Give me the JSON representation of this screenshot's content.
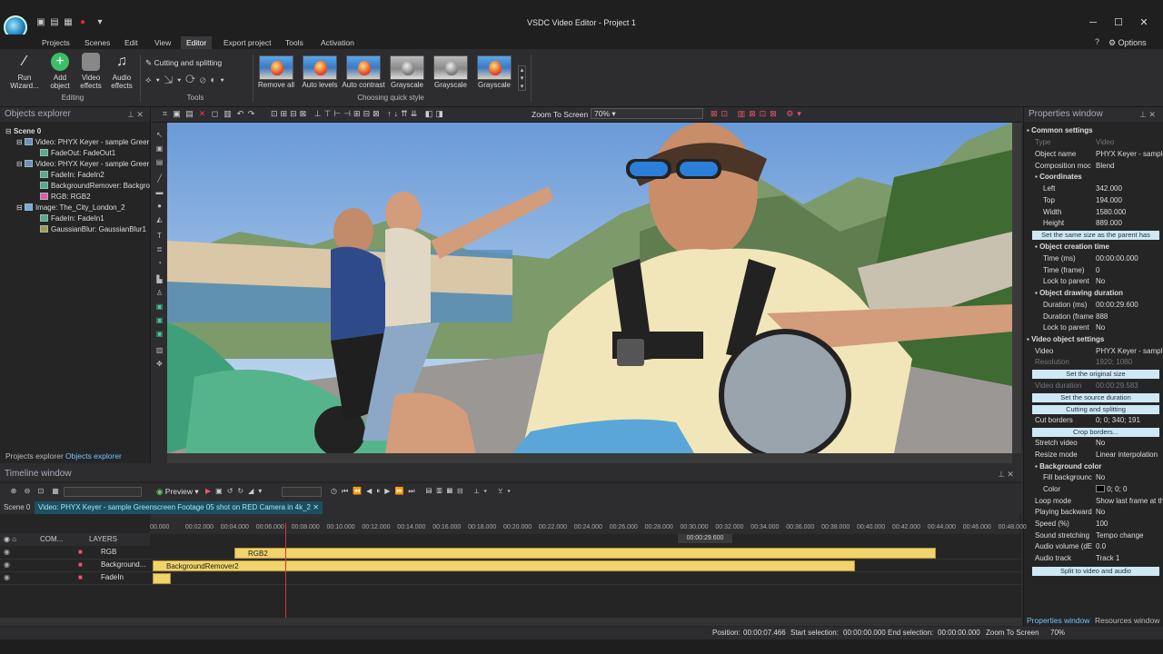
{
  "window": {
    "title": "VSDC Video Editor - Project 1"
  },
  "menu": [
    "Projects",
    "Scenes",
    "Edit",
    "View",
    "Editor",
    "Export project",
    "Tools",
    "Activation"
  ],
  "menu_active": "Editor",
  "options_label": "Options",
  "ribbon": {
    "run_wizard": "Run Wizard...",
    "add_object": "Add object",
    "video_effects": "Video effects",
    "audio_effects": "Audio effects",
    "editing_group": "Editing",
    "cutting_splitting": "Cutting and splitting",
    "tools_group": "Tools",
    "quick_styles": [
      "Remove all",
      "Auto levels",
      "Auto contrast",
      "Grayscale",
      "Grayscale",
      "Grayscale"
    ],
    "quick_group": "Choosing quick style"
  },
  "objects_explorer": {
    "title": "Objects explorer",
    "items": [
      "Scene 0",
      "Video: PHYX Keyer - sample Greer",
      "FadeOut: FadeOut1",
      "Video: PHYX Keyer - sample Greer",
      "FadeIn: FadeIn2",
      "BackgroundRemover: Backgro",
      "RGB: RGB2",
      "Image: The_City_London_2",
      "FadeIn: FadeIn1",
      "GaussianBlur: GaussianBlur1"
    ],
    "tabs": [
      "Projects explorer",
      "Objects explorer"
    ]
  },
  "canvas_toolbar": {
    "zoom_label": "Zoom To Screen",
    "zoom_value": "70%"
  },
  "properties": {
    "title": "Properties window",
    "common": "Common settings",
    "rows": [
      {
        "k": "Type",
        "v": "Video",
        "dis": true
      },
      {
        "k": "Object name",
        "v": "PHYX Keyer - sample"
      },
      {
        "k": "Composition moc",
        "v": "Blend"
      },
      {
        "k": "Coordinates",
        "v": "",
        "sec": true
      },
      {
        "k": "Left",
        "v": "342.000"
      },
      {
        "k": "Top",
        "v": "194.000"
      },
      {
        "k": "Width",
        "v": "1580.000"
      },
      {
        "k": "Height",
        "v": "889.000"
      }
    ],
    "btn_same_size": "Set the same size as the parent has",
    "creation_title": "Object creation time",
    "creation_rows": [
      {
        "k": "Time (ms)",
        "v": "00:00:00.000"
      },
      {
        "k": "Time (frame)",
        "v": "0"
      },
      {
        "k": "Lock to parent",
        "v": "No"
      }
    ],
    "duration_title": "Object drawing duration",
    "duration_rows": [
      {
        "k": "Duration (ms)",
        "v": "00:00:29.600"
      },
      {
        "k": "Duration (frame",
        "v": "888"
      },
      {
        "k": "Lock to parent",
        "v": "No"
      }
    ],
    "video_title": "Video object settings",
    "video_row": {
      "k": "Video",
      "v": "PHYX Keyer - sampl"
    },
    "resolution_row": {
      "k": "Resolution",
      "v": "1920; 1080"
    },
    "btn_original": "Set the original size",
    "vduration_row": {
      "k": "Video duration",
      "v": "00:00:29.583"
    },
    "btn_source": "Set the source duration",
    "btn_cutting": "Cutting and splitting",
    "cut_row": {
      "k": "Cut borders",
      "v": "0; 0; 340; 191"
    },
    "btn_crop": "Crop borders...",
    "stretch_row": {
      "k": "Stretch video",
      "v": "No"
    },
    "resize_row": {
      "k": "Resize mode",
      "v": "Linear interpolation"
    },
    "bg_title": "Background color",
    "bg_rows": [
      {
        "k": "Fill backgrounc",
        "v": "No"
      },
      {
        "k": "Color",
        "v": "0; 0; 0"
      }
    ],
    "tail_rows": [
      {
        "k": "Loop mode",
        "v": "Show last frame at th"
      },
      {
        "k": "Playing backward",
        "v": "No"
      },
      {
        "k": "Speed (%)",
        "v": "100"
      },
      {
        "k": "Sound stretching",
        "v": "Tempo change"
      },
      {
        "k": "Audio volume (dE",
        "v": "0.0"
      },
      {
        "k": "Audio track",
        "v": "Track 1"
      }
    ],
    "btn_split": "Split to video and audio",
    "tabs": [
      "Properties window",
      "Resources window"
    ]
  },
  "timeline": {
    "title": "Timeline window",
    "preview": "Preview",
    "tabs": [
      "Scene 0",
      "Video: PHYX Keyer - sample Greenscreen Footage 05 shot on RED Camera in 4k_2"
    ],
    "ticks": [
      "00.000",
      "00:02.000",
      "00:04.000",
      "00:06.000",
      "00:08.000",
      "00:10.000",
      "00:12.000",
      "00:14.000",
      "00:16.000",
      "00:18.000",
      "00:20.000",
      "00:22.000",
      "00:24.000",
      "00:26.000",
      "00:28.000",
      "00:30.000",
      "00:32.000",
      "00:34.000",
      "00:36.000",
      "00:38.000",
      "00:40.000",
      "00:42.000",
      "00:44.000",
      "00:46.000",
      "00:48.000"
    ],
    "marker": "00:00:29.600",
    "header_com": "COM...",
    "header_layers": "LAYERS",
    "tracks": [
      {
        "name": "RGB",
        "clip": "RGB2"
      },
      {
        "name": "Background...",
        "clip": "BackgroundRemover2"
      },
      {
        "name": "FadeIn",
        "clip": ""
      }
    ]
  },
  "status": {
    "position_label": "Position:",
    "position": "00:00:07.466",
    "start_label": "Start selection:",
    "start": "00:00:00.000",
    "end_label": "End selection:",
    "end": "00:00:00.000",
    "zoom_label": "Zoom To Screen",
    "zoom": "70%"
  }
}
